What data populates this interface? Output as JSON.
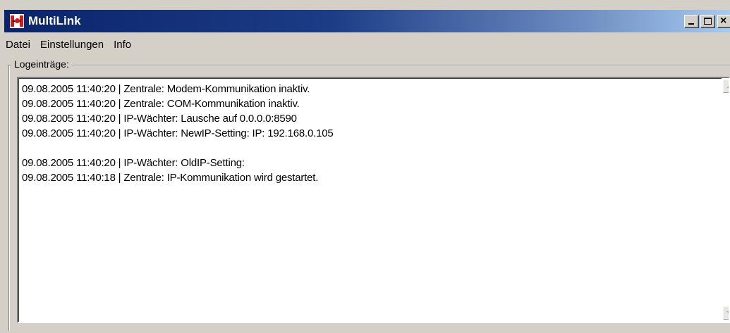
{
  "window": {
    "title": "MultiLink",
    "icon": "multilink-app-icon",
    "buttons": {
      "minimize": "minimize-icon",
      "maximize": "maximize-icon",
      "close": "close-icon",
      "close_glyph": "×"
    }
  },
  "menu": {
    "items": [
      "Datei",
      "Einstellungen",
      "Info"
    ]
  },
  "log_group": {
    "label": "Logeinträge:",
    "lines": [
      "09.08.2005 11:40:20 | Zentrale: Modem-Kommunikation inaktiv.",
      "09.08.2005 11:40:20 | Zentrale: COM-Kommunikation inaktiv.",
      "09.08.2005 11:40:20 | IP-Wächter: Lausche auf 0.0.0.0:8590",
      "09.08.2005 11:40:20 | IP-Wächter: NewIP-Setting: IP: 192.168.0.105",
      "",
      "09.08.2005 11:40:20 | IP-Wächter: OldIP-Setting:",
      "09.08.2005 11:40:18 | Zentrale: IP-Kommunikation wird gestartet."
    ]
  },
  "scrollbar": {
    "up_icon": "scroll-up-arrow-icon",
    "down_icon": "scroll-down-arrow-icon",
    "enabled": false
  }
}
